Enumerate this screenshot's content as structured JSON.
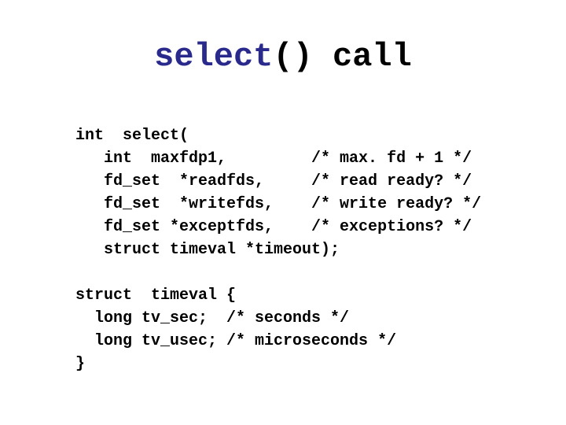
{
  "title": {
    "fn": "select",
    "parens": "()",
    "word": " call"
  },
  "code": {
    "l1": "int  select(",
    "l2": "   int  maxfdp1,         /* max. fd + 1 */",
    "l3": "   fd_set  *readfds,     /* read ready? */",
    "l4": "   fd_set  *writefds,    /* write ready? */",
    "l5": "   fd_set *exceptfds,    /* exceptions? */",
    "l6": "   struct timeval *timeout);",
    "blank": "",
    "s1": "struct  timeval {",
    "s2": "  long tv_sec;  /* seconds */",
    "s3": "  long tv_usec; /* microseconds */",
    "s4": "}"
  }
}
